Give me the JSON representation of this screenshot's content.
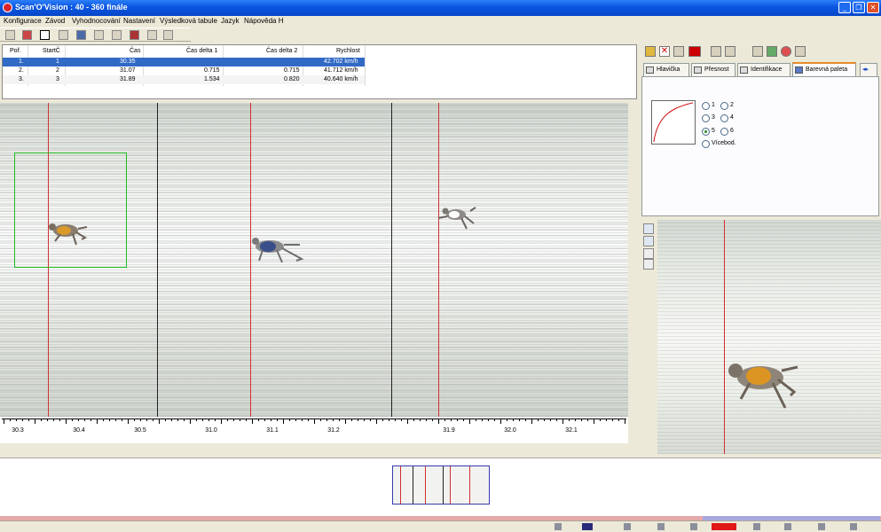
{
  "window": {
    "title": "Scan'O'Vision : 40 - 360 finále"
  },
  "menu": [
    "Konfigurace",
    "Závod",
    "Vyhodnocování",
    "Nastavení",
    "Výsledková tabule",
    "Jazyk",
    "Nápověda H"
  ],
  "table": {
    "headers": [
      "Poř.",
      "StartČ",
      "Čas",
      "Čas delta 1",
      "Čas delta 2",
      "Rychlost"
    ],
    "rows": [
      {
        "rank": "1.",
        "start": "1",
        "time": "30.35",
        "d1": "",
        "d2": "",
        "speed": "42.702 km/h"
      },
      {
        "rank": "2.",
        "start": "2",
        "time": "31.07",
        "d1": "0.715",
        "d2": "0.715",
        "speed": "41.712 km/h"
      },
      {
        "rank": "3.",
        "start": "3",
        "time": "31.89",
        "d1": "1.534",
        "d2": "0.820",
        "speed": "40.640 km/h"
      }
    ]
  },
  "axis": {
    "labels": [
      "30.3",
      "30.4",
      "30.5",
      "31.0",
      "31.1",
      "31.2",
      "31.9",
      "32.0",
      "32.1"
    ]
  },
  "tabs": [
    "Hlavička",
    "Přesnost",
    "Identifikace",
    "Barevná paleta"
  ],
  "palette": {
    "options": [
      "1",
      "2",
      "3",
      "4",
      "5",
      "6",
      "Vícebod."
    ],
    "selected": "5"
  },
  "colors": {
    "titlebar": "#0a55e0",
    "selection": "#316ac5",
    "finish_line": "#d23030",
    "zoom_box": "#22bb22"
  }
}
